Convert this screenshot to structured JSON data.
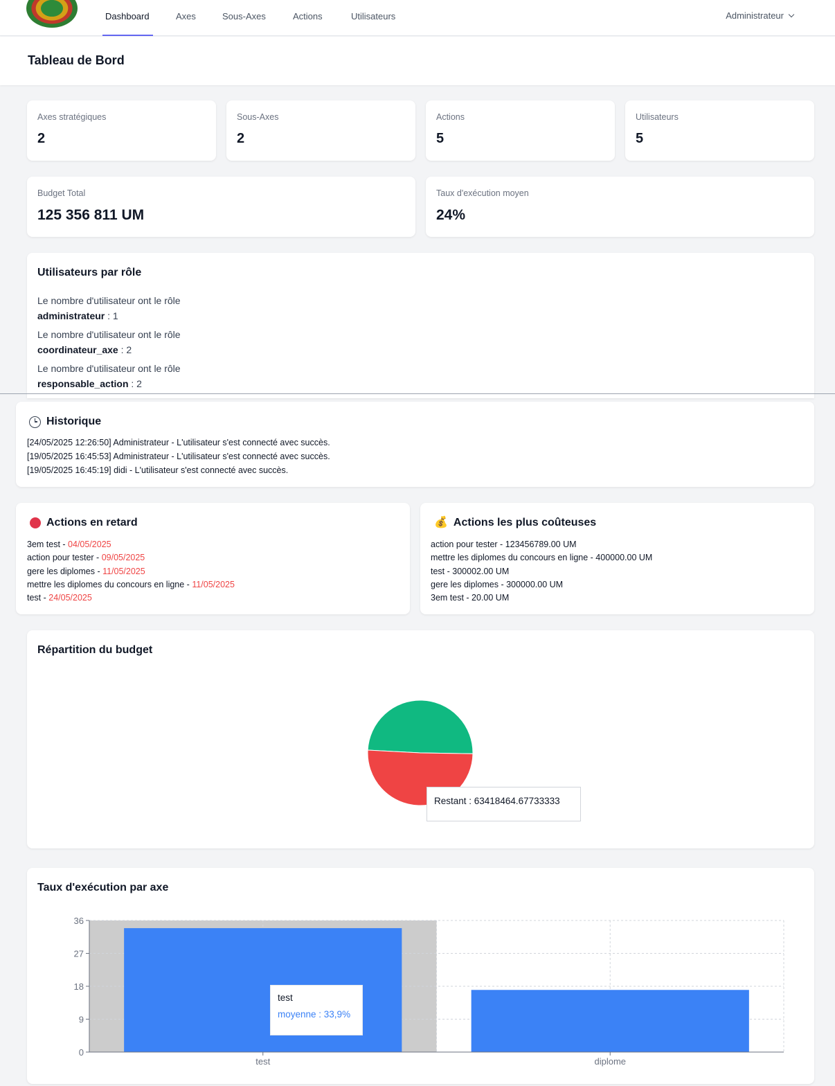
{
  "nav": {
    "items": [
      "Dashboard",
      "Axes",
      "Sous-Axes",
      "Actions",
      "Utilisateurs"
    ],
    "active": "Dashboard",
    "user": "Administrateur"
  },
  "page": {
    "title": "Tableau de Bord"
  },
  "stats": [
    {
      "label": "Axes stratégiques",
      "value": "2"
    },
    {
      "label": "Sous-Axes",
      "value": "2"
    },
    {
      "label": "Actions",
      "value": "5"
    },
    {
      "label": "Utilisateurs",
      "value": "5"
    },
    {
      "label": "Budget Total",
      "value": "125 356 811 UM"
    },
    {
      "label": "Taux d'exécution moyen",
      "value": "24%"
    }
  ],
  "roles": {
    "title": "Utilisateurs par rôle",
    "prefix": "Le nombre d'utilisateur ont le rôle",
    "items": [
      {
        "role": "administrateur",
        "count": " : 1"
      },
      {
        "role": "coordinateur_axe",
        "count": " : 2"
      },
      {
        "role": "responsable_action",
        "count": " : 2"
      }
    ]
  },
  "history": {
    "title": "Historique",
    "icon": "clock-icon",
    "entries": [
      "[24/05/2025 12:26:50] Administrateur - L'utilisateur s'est connecté avec succès.",
      "[19/05/2025 16:45:53] Administrateur - L'utilisateur s'est connecté avec succès.",
      "[19/05/2025 16:45:19] didi - L'utilisateur s'est connecté avec succès."
    ]
  },
  "late": {
    "title": "Actions en retard",
    "icon": "red-circle-icon",
    "items": [
      {
        "name": "3em test - ",
        "date": "04/05/2025"
      },
      {
        "name": "action pour tester - ",
        "date": "09/05/2025"
      },
      {
        "name": "gere les diplomes - ",
        "date": "11/05/2025"
      },
      {
        "name": "mettre les diplomes du concours en ligne - ",
        "date": "11/05/2025"
      },
      {
        "name": "test - ",
        "date": "24/05/2025"
      }
    ]
  },
  "costly": {
    "title": "Actions les plus coûteuses",
    "icon": "money-bag-icon",
    "items": [
      "action pour tester - 123456789.00 UM",
      "mettre les diplomes du concours en ligne - 400000.00 UM",
      "test - 300002.00 UM",
      "gere les diplomes - 300000.00 UM",
      "3em test - 20.00 UM"
    ]
  },
  "pie": {
    "title": "Répartition du budget",
    "tooltip": "Restant : 63418464.67733333"
  },
  "bars": {
    "title": "Taux d'exécution par axe",
    "tooltip_title": "test",
    "tooltip_value": "moyenne : 33,9%"
  },
  "colors": {
    "green": "#10b981",
    "red": "#ef4444",
    "blue": "#3b82f6",
    "highlight": "#cccccc"
  },
  "chart_data": [
    {
      "type": "pie",
      "title": "Répartition du budget",
      "slices": [
        {
          "name": "",
          "value": 61938346.32,
          "color": "#10b981"
        },
        {
          "name": "Restant",
          "value": 63418464.67733333,
          "color": "#ef4444"
        }
      ]
    },
    {
      "type": "bar",
      "title": "Taux d'exécution par axe",
      "categories": [
        "test",
        "diplome"
      ],
      "values": [
        33.9,
        17
      ],
      "ylim": [
        0,
        36
      ],
      "yticks": [
        0,
        9,
        18,
        27,
        36
      ],
      "grid": true,
      "highlighted": "test"
    }
  ]
}
